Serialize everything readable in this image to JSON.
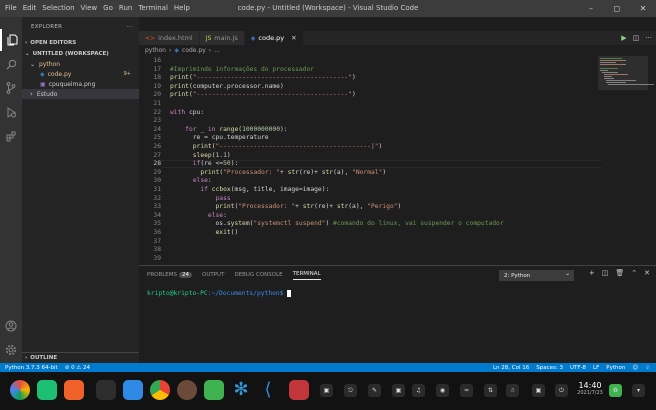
{
  "window": {
    "title": "code.py - Untitled (Workspace) - Visual Studio Code",
    "menu": [
      "File",
      "Edit",
      "Selection",
      "View",
      "Go",
      "Run",
      "Terminal",
      "Help"
    ]
  },
  "sidebar": {
    "header": "EXPLORER",
    "open_editors": "OPEN EDITORS",
    "workspace": "UNTITLED (WORKSPACE)",
    "items": [
      {
        "label": "python",
        "kind": "folder-open"
      },
      {
        "label": "code.py",
        "kind": "py",
        "badge": "9+"
      },
      {
        "label": "cpuqueima.png",
        "kind": "png"
      },
      {
        "label": "Estudo",
        "kind": "folder"
      }
    ],
    "outline": "OUTLINE"
  },
  "tabs": [
    {
      "label": "index.html",
      "icon": "html"
    },
    {
      "label": "main.js",
      "icon": "js"
    },
    {
      "label": "code.py",
      "icon": "py",
      "active": true
    }
  ],
  "breadcrumb": [
    "python",
    "code.py",
    "..."
  ],
  "editor": {
    "current_line": "28",
    "lines": [
      {
        "n": "16",
        "t": ""
      },
      {
        "n": "17",
        "t": "#Imprimindo informações do processador"
      },
      {
        "n": "18",
        "t": "print(\"----------------------------------------\")"
      },
      {
        "n": "19",
        "t": "print(computer.processor.name)"
      },
      {
        "n": "20",
        "t": "print(\"----------------------------------------\")"
      },
      {
        "n": "21",
        "t": ""
      },
      {
        "n": "22",
        "t": "with cpu:"
      },
      {
        "n": "23",
        "t": ""
      },
      {
        "n": "24",
        "t": "    for _ in range(1000000000):"
      },
      {
        "n": "25",
        "t": "      re = cpu.temperature"
      },
      {
        "n": "26",
        "t": "      print(\"----------------------------------------|\")"
      },
      {
        "n": "27",
        "t": "      sleep(1.1)"
      },
      {
        "n": "28",
        "t": "      if(re <=50):"
      },
      {
        "n": "29",
        "t": "        print(\"Processador: \"+ str(re)+ str(a), \"Normal\")"
      },
      {
        "n": "30",
        "t": "      else:"
      },
      {
        "n": "31",
        "t": "        if ccbox(msg, title, image=image):"
      },
      {
        "n": "32",
        "t": "            pass"
      },
      {
        "n": "33",
        "t": "            print(\"Processador: \"+ str(re)+ str(a), \"Perigo\")"
      },
      {
        "n": "34",
        "t": "          else:"
      },
      {
        "n": "35",
        "t": "            os.system(\"systemctl suspend\") #comando do linux, vai suspender o computador"
      },
      {
        "n": "36",
        "t": "            exit()"
      },
      {
        "n": "37",
        "t": ""
      },
      {
        "n": "38",
        "t": ""
      },
      {
        "n": "39",
        "t": ""
      }
    ]
  },
  "panel": {
    "tabs": [
      "PROBLEMS",
      "OUTPUT",
      "DEBUG CONSOLE",
      "TERMINAL"
    ],
    "problems_count": "24",
    "active_tab": "TERMINAL",
    "terminal_select": "2: Python",
    "prompt_user": "kripto@kripto-PC",
    "prompt_path": ":~/Documents/python$"
  },
  "statusbar": {
    "python": "Python 3.7.3 64-bit",
    "problems": "⊘ 0 ⚠ 24",
    "position": "Ln 28, Col 16",
    "spaces": "Spaces: 3",
    "encoding": "UTF-8",
    "eol": "LF",
    "language": "Python"
  },
  "taskbar": {
    "time": "14:40",
    "date": "2021/7/23"
  },
  "colors": {
    "accent": "#007acc",
    "keyword": "#c586c0",
    "string": "#ce9178",
    "comment": "#6a9955",
    "function": "#dcdcaa",
    "number": "#b5cea8",
    "variable": "#9cdcfe",
    "prompt_user": "#23d18b",
    "prompt_path": "#3b8eea"
  }
}
